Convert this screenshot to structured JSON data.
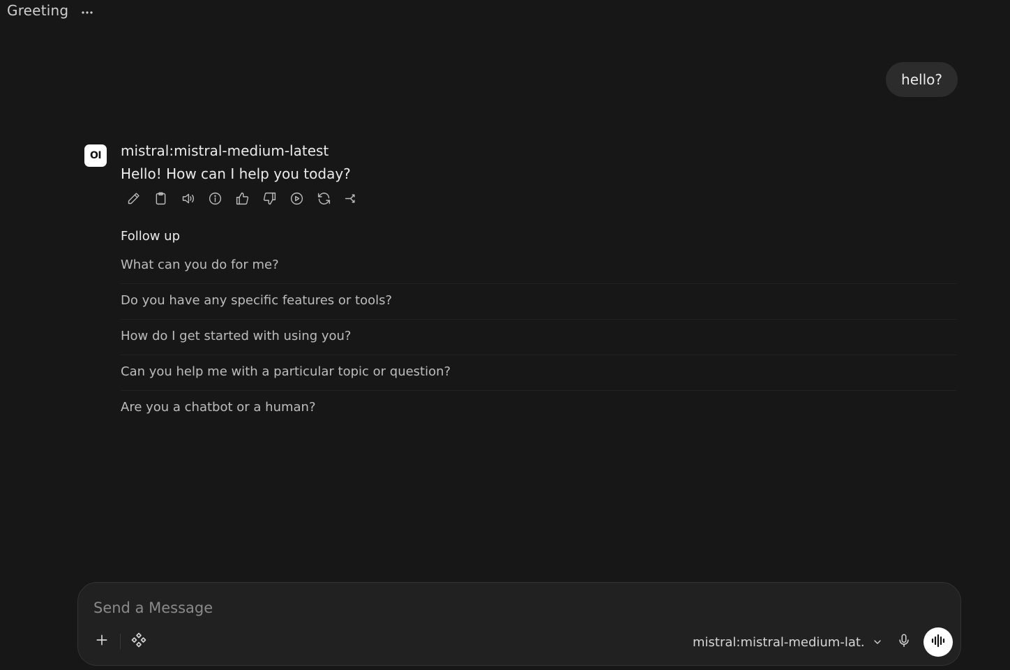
{
  "header": {
    "chat_title": "Greeting",
    "more_icon": "ellipsis-icon"
  },
  "conversation": {
    "user_message": "hello?",
    "assistant": {
      "avatar_text": "OI",
      "model_name": "mistral:mistral-medium-latest",
      "message": "Hello! How can I help you today?",
      "actions": [
        {
          "name": "edit-button",
          "icon": "pencil-icon"
        },
        {
          "name": "copy-button",
          "icon": "clipboard-icon"
        },
        {
          "name": "read-aloud-button",
          "icon": "speaker-icon"
        },
        {
          "name": "generation-info-button",
          "icon": "info-icon"
        },
        {
          "name": "good-response-button",
          "icon": "thumbs-up-icon"
        },
        {
          "name": "bad-response-button",
          "icon": "thumbs-down-icon"
        },
        {
          "name": "continue-response-button",
          "icon": "play-circle-icon"
        },
        {
          "name": "regenerate-button",
          "icon": "refresh-icon"
        },
        {
          "name": "branch-button",
          "icon": "branch-icon"
        }
      ]
    },
    "follow_up": {
      "title": "Follow up",
      "items": [
        "What can you do for me?",
        "Do you have any specific features or tools?",
        "How do I get started with using you?",
        "Can you help me with a particular topic or question?",
        "Are you a chatbot or a human?"
      ]
    }
  },
  "composer": {
    "placeholder": "Send a Message",
    "model_selector_label": "mistral:mistral-medium-lat...",
    "left_icons": [
      "plus-icon",
      "integrations-icon"
    ],
    "right_icons": [
      "chevron-down-icon",
      "microphone-icon",
      "voice-waveform-icon"
    ]
  },
  "colors": {
    "background": "#171717",
    "bubble": "#2c2c2c",
    "composer": "#212121",
    "text": "#ececec",
    "muted_text": "#bdbdbd"
  }
}
